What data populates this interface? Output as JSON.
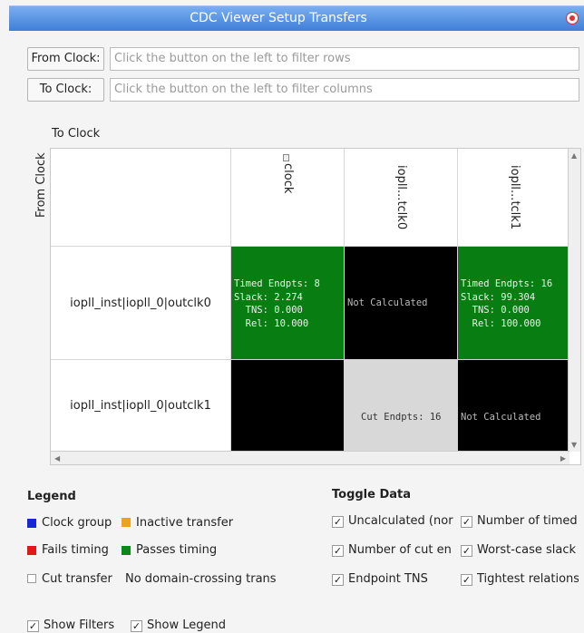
{
  "window": {
    "title": "CDC Viewer Setup Transfers"
  },
  "filters": {
    "from_clock_button": "From Clock:",
    "from_clock_placeholder": "Click the button on the left to filter rows",
    "to_clock_button": "To Clock:",
    "to_clock_placeholder": "Click the button on the left to filter columns"
  },
  "matrix": {
    "to_clock_label": "To Clock",
    "from_clock_label": "From Clock",
    "columns": [
      "clock",
      "iopll...tclk0",
      "iopll...tclk1"
    ],
    "rows": [
      {
        "label": "iopll_inst|iopll_0|outclk0",
        "cells": [
          {
            "state": "green",
            "text": "Timed Endpts: 8\nSlack: 2.274\n  TNS: 0.000\n  Rel: 10.000"
          },
          {
            "state": "black",
            "text": "Not Calculated"
          },
          {
            "state": "green",
            "text": "Timed Endpts: 16\nSlack: 99.304\n  TNS: 0.000\n  Rel: 100.000"
          }
        ]
      },
      {
        "label": "iopll_inst|iopll_0|outclk1",
        "cells": [
          {
            "state": "black",
            "text": ""
          },
          {
            "state": "grey",
            "text": "Cut Endpts: 16"
          },
          {
            "state": "black",
            "text": "Not Calculated"
          }
        ]
      }
    ]
  },
  "legend": {
    "title": "Legend",
    "items": [
      {
        "label": "Clock group",
        "color": "#1428d8"
      },
      {
        "label": "Inactive transfer",
        "color": "#f0a020"
      },
      {
        "label": "Fails timing",
        "color": "#e01818"
      },
      {
        "label": "Passes timing",
        "color": "#0a8a14"
      },
      {
        "label": "Cut transfer",
        "color": "#ffffff"
      },
      {
        "label": "No domain-crossing trans",
        "color": ""
      }
    ]
  },
  "toggle": {
    "title": "Toggle Data",
    "items": [
      {
        "label": "Uncalculated (nor",
        "checked": true
      },
      {
        "label": "Number of timed e",
        "checked": true
      },
      {
        "label": "Number of cut en",
        "checked": true
      },
      {
        "label": "Worst-case slack",
        "checked": true
      },
      {
        "label": "Endpoint TNS",
        "checked": true
      },
      {
        "label": "Tightest relations",
        "checked": true
      }
    ]
  },
  "bottom": {
    "show_filters": "Show Filters",
    "show_legend": "Show Legend",
    "check_mark": "✓"
  }
}
